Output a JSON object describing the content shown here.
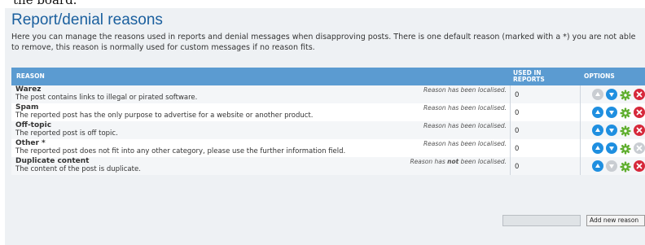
{
  "top_fragment": "the board.",
  "title": "Report/denial reasons",
  "description": "Here you can manage the reasons used in reports and denial messages when disapproving posts. There is one default reason (marked with a *) you are not able to remove, this reason is normally used for custom messages if no reason fits.",
  "table": {
    "headers": {
      "reason": "REASON",
      "used": "USED IN REPORTS",
      "options": "OPTIONS"
    },
    "rows": [
      {
        "title": "Warez",
        "text": "The post contains links to illegal or pirated software.",
        "status_pre": "Reason has been localised.",
        "status_mid": "",
        "status_post": "",
        "count": "0",
        "icons": [
          "move-up-disabled",
          "move-down",
          "edit",
          "delete"
        ]
      },
      {
        "title": "Spam",
        "text": "The reported post has the only purpose to advertise for a website or another product.",
        "status_pre": "Reason has been localised.",
        "status_mid": "",
        "status_post": "",
        "count": "0",
        "icons": [
          "move-up",
          "move-down",
          "edit",
          "delete"
        ]
      },
      {
        "title": "Off-topic",
        "text": "The reported post is off topic.",
        "status_pre": "Reason has been localised.",
        "status_mid": "",
        "status_post": "",
        "count": "0",
        "icons": [
          "move-up",
          "move-down",
          "edit",
          "delete"
        ]
      },
      {
        "title": "Other *",
        "text": "The reported post does not fit into any other category, please use the further information field.",
        "status_pre": "Reason has been localised.",
        "status_mid": "",
        "status_post": "",
        "count": "0",
        "icons": [
          "move-up",
          "move-down",
          "edit",
          "delete-disabled"
        ]
      },
      {
        "title": "Duplicate content",
        "text": "The content of the post is duplicate.",
        "status_pre": "Reason has ",
        "status_mid": "not",
        "status_post": " been localised.",
        "count": "0",
        "icons": [
          "move-up",
          "move-down-disabled",
          "edit",
          "delete"
        ]
      }
    ]
  },
  "add_button_label": "Add new reason",
  "colors": {
    "title": "#1a5f9e",
    "header": "#5b9bd1",
    "icon_blue": "#1f8fe0",
    "icon_red": "#d6283a",
    "icon_green": "#5fae2e"
  }
}
